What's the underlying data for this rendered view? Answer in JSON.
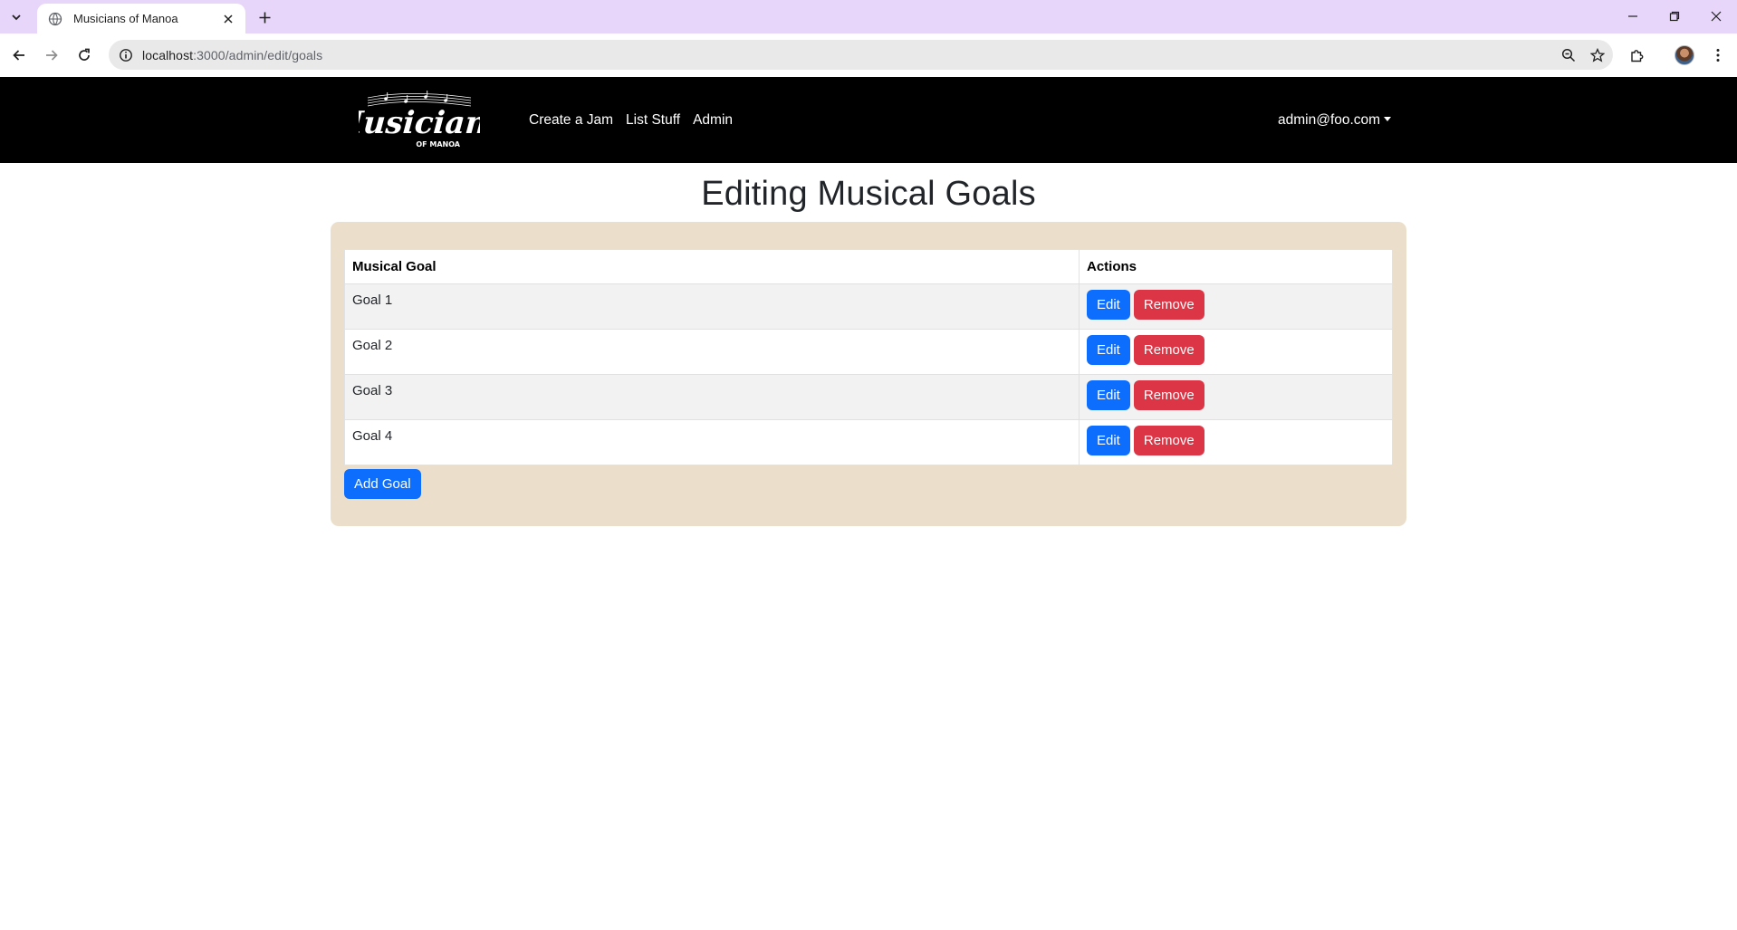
{
  "browser": {
    "tab_title": "Musicians of Manoa",
    "url_host": "localhost",
    "url_rest": ":3000/admin/edit/goals"
  },
  "navbar": {
    "logo_text": "Musicians",
    "logo_subtext": "OF MANOA",
    "links": [
      "Create a Jam",
      "List Stuff",
      "Admin"
    ],
    "user_email": "admin@foo.com"
  },
  "page": {
    "title": "Editing Musical Goals",
    "table": {
      "headers": [
        "Musical Goal",
        "Actions"
      ],
      "rows": [
        {
          "goal": "Goal 1"
        },
        {
          "goal": "Goal 2"
        },
        {
          "goal": "Goal 3"
        },
        {
          "goal": "Goal 4"
        }
      ],
      "edit_label": "Edit",
      "remove_label": "Remove"
    },
    "add_button_label": "Add Goal"
  },
  "colors": {
    "navbar_bg": "#000000",
    "card_bg": "#ebdfcb",
    "primary": "#0d6efd",
    "danger": "#dc3545",
    "tabbar_bg": "#e8d5fa"
  }
}
